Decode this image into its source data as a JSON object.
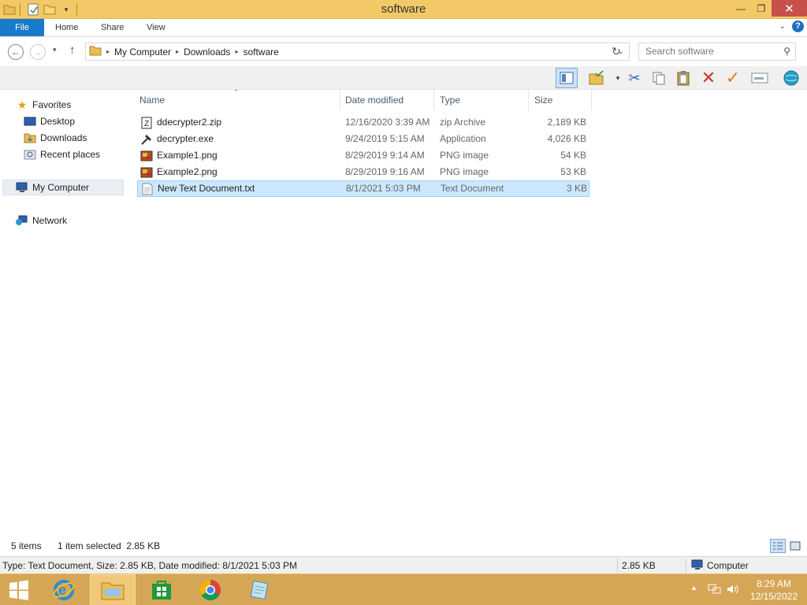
{
  "window": {
    "title": "software"
  },
  "ribbon": {
    "tabs": [
      "File",
      "Home",
      "Share",
      "View"
    ]
  },
  "address": {
    "crumbs": [
      "My Computer",
      "Downloads",
      "software"
    ],
    "search_placeholder": "Search software"
  },
  "nav": {
    "favorites": "Favorites",
    "favorite_items": [
      "Desktop",
      "Downloads",
      "Recent places"
    ],
    "my_computer": "My Computer",
    "network": "Network"
  },
  "columns": [
    "Name",
    "Date modified",
    "Type",
    "Size"
  ],
  "files": [
    {
      "name": "ddecrypter2.zip",
      "date": "12/16/2020 3:39 AM",
      "type": "zip Archive",
      "size": "2,189 KB",
      "icon": "zip-icon"
    },
    {
      "name": "decrypter.exe",
      "date": "9/24/2019 5:15 AM",
      "type": "Application",
      "size": "4,026 KB",
      "icon": "exe-icon"
    },
    {
      "name": "Example1.png",
      "date": "8/29/2019 9:14 AM",
      "type": "PNG image",
      "size": "54 KB",
      "icon": "png-icon"
    },
    {
      "name": "Example2.png",
      "date": "8/29/2019 9:16 AM",
      "type": "PNG image",
      "size": "53 KB",
      "icon": "png-icon"
    },
    {
      "name": "New Text Document.txt",
      "date": "8/1/2021 5:03 PM",
      "type": "Text Document",
      "size": "3 KB",
      "icon": "txt-icon",
      "selected": true
    }
  ],
  "status": {
    "items_count": "5 items",
    "selection": "1 item selected  2.85 KB",
    "details": "Type: Text Document, Size: 2.85 KB, Date modified: 8/1/2021 5:03 PM",
    "size": "2.85 KB",
    "location": "Computer"
  },
  "taskbar": {
    "time": "8:29 AM",
    "date": "12/15/2022"
  },
  "colors": {
    "titlebar": "#f3c968",
    "taskbar": "#d5a656",
    "file_tab": "#1979ca",
    "selection": "#cce8ff",
    "close_button": "#c7504a"
  }
}
